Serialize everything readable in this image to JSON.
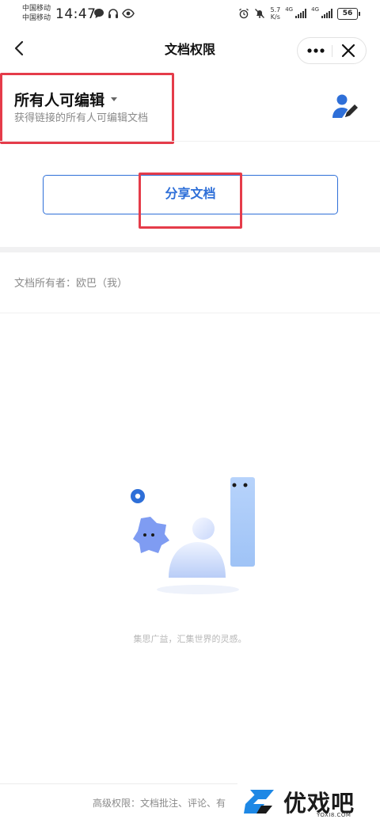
{
  "status_bar": {
    "carrier1": "中国移动",
    "carrier2": "中国移动",
    "time": "14:47",
    "net_speed_value": "5.7",
    "net_speed_unit": "K/s",
    "net_type1": "4G",
    "net_type2": "4G",
    "battery": "56"
  },
  "nav": {
    "title": "文档权限",
    "icons": [
      "back-icon",
      "more-icon",
      "close-icon"
    ]
  },
  "permission": {
    "title": "所有人可编辑",
    "description": "获得链接的所有人可编辑文档",
    "icon": "user-edit-icon"
  },
  "share_button": {
    "label": "分享文档"
  },
  "owner": {
    "text": "文档所有者：欧巴（我）"
  },
  "empty_state": {
    "tagline": "集思广益，汇集世界的灵感。"
  },
  "footer": {
    "text": "高级权限：文档批注、评论、有"
  },
  "watermark": {
    "brand": "优戏吧",
    "url": "YOXI8.COM"
  },
  "colors": {
    "accent": "#2e6fd8",
    "highlight": "#e53c4a",
    "muted_text": "#8a8a8a"
  }
}
